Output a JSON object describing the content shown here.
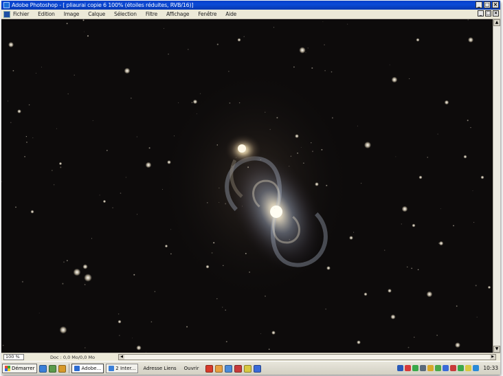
{
  "window": {
    "title": "Adobe Photoshop - [ pliaurai copie 6 100% (étoiles réduites, RVB/16)]",
    "controls": [
      "_",
      "□",
      "×"
    ]
  },
  "menu": {
    "items": [
      "Fichier",
      "Edition",
      "Image",
      "Calque",
      "Sélection",
      "Filtre",
      "Affichage",
      "Fenêtre",
      "Aide"
    ],
    "doc_controls": [
      "_",
      "□",
      "×"
    ]
  },
  "canvas": {
    "subject": "spiral-galaxy-photo",
    "background": "#0d0b0b"
  },
  "status": {
    "zoom": "100 %",
    "doc_info": "Doc : 0,0 Mo/0,0 Mo"
  },
  "taskbar": {
    "start_label": "Démarrer",
    "tasks": [
      {
        "label": "Adobe...",
        "active": true
      },
      {
        "label": "2 Inter..."
      },
      {
        "label": "Adresse Liens"
      },
      {
        "label": "Ouvrir"
      }
    ],
    "clock": "10:33"
  },
  "colors": {
    "titlebar": "#0b4bd8",
    "chrome": "#ece9d8",
    "canvas": "#0d0b0b"
  }
}
